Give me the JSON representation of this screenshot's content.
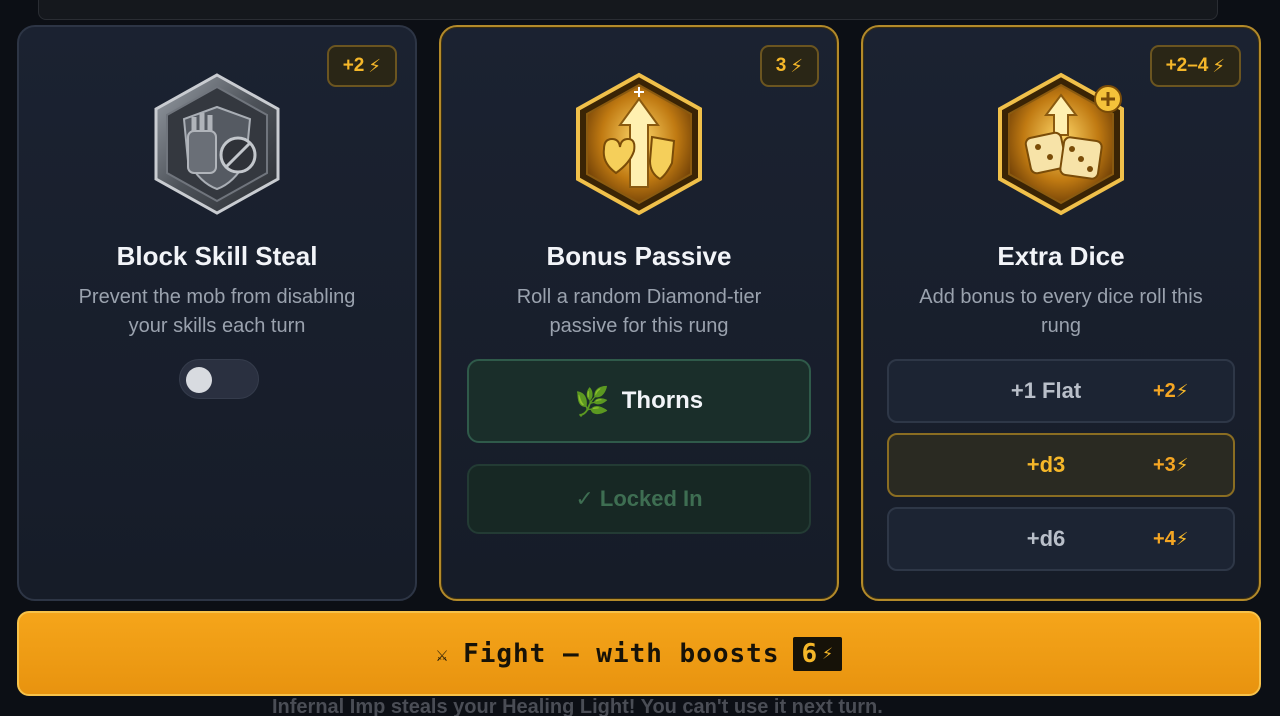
{
  "background": {
    "bottom_text": "Infernal Imp steals your Healing Light! You can't use it next turn."
  },
  "cards": [
    {
      "title": "Block Skill Steal",
      "description": "Prevent the mob from disabling your skills each turn",
      "cost": "+2",
      "icon": "shield-gauntlet-icon",
      "toggle_state": "off"
    },
    {
      "title": "Bonus Passive",
      "description": "Roll a random Diamond-tier passive for this rung",
      "cost": "3",
      "icon": "bonus-passive-icon",
      "passive_name": "Thorns",
      "passive_icon": "leaf-icon",
      "locked_label": "✓ Locked In"
    },
    {
      "title": "Extra Dice",
      "description": "Add bonus to every dice roll this rung",
      "cost": "+2–4",
      "icon": "dice-icon",
      "options": [
        {
          "label": "+1 Flat",
          "cost": "+2"
        },
        {
          "label": "+d3",
          "cost": "+3",
          "selected": true
        },
        {
          "label": "+d6",
          "cost": "+4"
        }
      ]
    }
  ],
  "fight_button": {
    "label": "Fight — with boosts",
    "cost": "6",
    "icon": "swords-icon"
  },
  "colors": {
    "accent_gold": "#f5b729",
    "fight_orange": "#f5a51a",
    "card_bg": "#1b2231"
  }
}
